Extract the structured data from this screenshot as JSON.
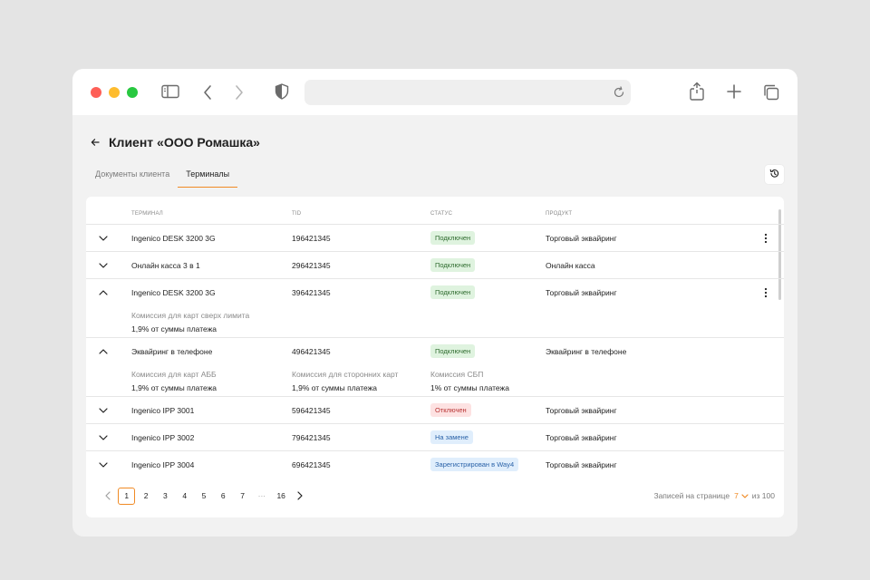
{
  "page": {
    "title": "Клиент «ООО Ромашка»"
  },
  "tabs": [
    {
      "label": "Документы клиента",
      "active": false
    },
    {
      "label": "Терминалы",
      "active": true
    }
  ],
  "table": {
    "headers": {
      "terminal": "Терминал",
      "tid": "TID",
      "status": "Статус",
      "product": "Продукт"
    },
    "rows": [
      {
        "terminal": "Ingenico DESK 3200 3G",
        "tid": "196421345",
        "status": "Подключен",
        "status_type": "ok",
        "product": "Торговый эквайринг",
        "expanded": false,
        "menu": true
      },
      {
        "terminal": "Онлайн касса 3 в 1",
        "tid": "296421345",
        "status": "Подключен",
        "status_type": "ok",
        "product": "Онлайн касса",
        "expanded": false,
        "menu": false
      },
      {
        "terminal": "Ingenico DESK 3200 3G",
        "tid": "396421345",
        "status": "Подключен",
        "status_type": "ok",
        "product": "Торговый эквайринг",
        "expanded": true,
        "menu": true,
        "details": [
          {
            "label": "Комиссия для карт сверх лимита",
            "value": "1,9% от суммы платежа"
          }
        ]
      },
      {
        "terminal": "Эквайринг в телефоне",
        "tid": "496421345",
        "status": "Подключен",
        "status_type": "ok",
        "product": "Эквайринг в телефоне",
        "expanded": true,
        "menu": false,
        "details": [
          {
            "label": "Комиссия для карт АББ",
            "value": "1,9% от суммы платежа"
          },
          {
            "label": "Комиссия для сторонних карт",
            "value": "1,9% от суммы платежа"
          },
          {
            "label": "Комиссия СБП",
            "value": "1% от суммы платежа"
          }
        ]
      },
      {
        "terminal": "Ingenico IPP 3001",
        "tid": "596421345",
        "status": "Отключен",
        "status_type": "off",
        "product": "Торговый эквайринг",
        "expanded": false,
        "menu": false
      },
      {
        "terminal": "Ingenico IPP 3002",
        "tid": "796421345",
        "status": "На замене",
        "status_type": "repl",
        "product": "Торговый эквайринг",
        "expanded": false,
        "menu": false
      },
      {
        "terminal": "Ingenico IPP 3004",
        "tid": "696421345",
        "status": "Зарегистрирован в Way4",
        "status_type": "reg",
        "product": "Торговый эквайринг",
        "expanded": false,
        "menu": false
      }
    ]
  },
  "pagination": {
    "pages": [
      "1",
      "2",
      "3",
      "4",
      "5",
      "6",
      "7",
      "···",
      "16"
    ],
    "current": "1",
    "per_page_label": "Записей на странице",
    "per_page_value": "7",
    "total_label": "из 100"
  },
  "colors": {
    "accent": "#f08a24",
    "status_ok_bg": "#dff3df",
    "status_off_bg": "#fde2e2",
    "status_info_bg": "#e0eefc"
  },
  "icons": {
    "back": "arrow-left-icon",
    "history": "history-icon",
    "expand": "chevron-down-icon",
    "collapse": "chevron-up-icon",
    "menu": "kebab-icon"
  }
}
